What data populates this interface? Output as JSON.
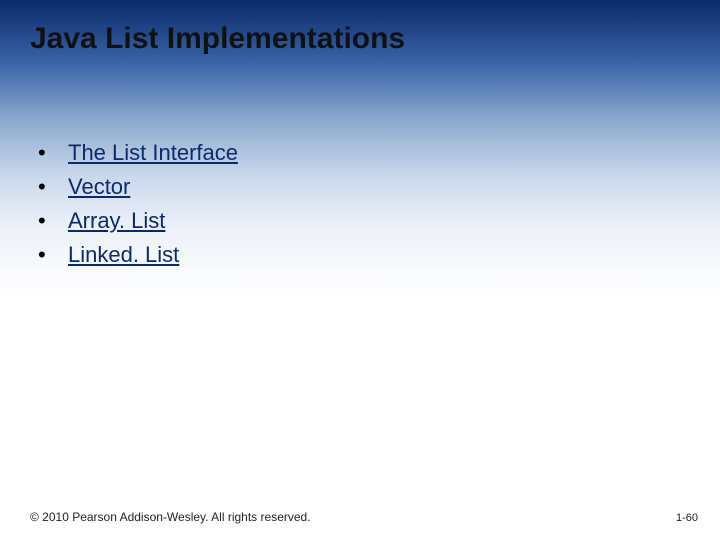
{
  "title": "Java List Implementations",
  "items": [
    {
      "label": "The List Interface"
    },
    {
      "label": "Vector"
    },
    {
      "label": "Array. List"
    },
    {
      "label": "Linked. List"
    }
  ],
  "footer": {
    "copyright": "© 2010 Pearson Addison-Wesley. All rights reserved.",
    "page": "1-60"
  }
}
